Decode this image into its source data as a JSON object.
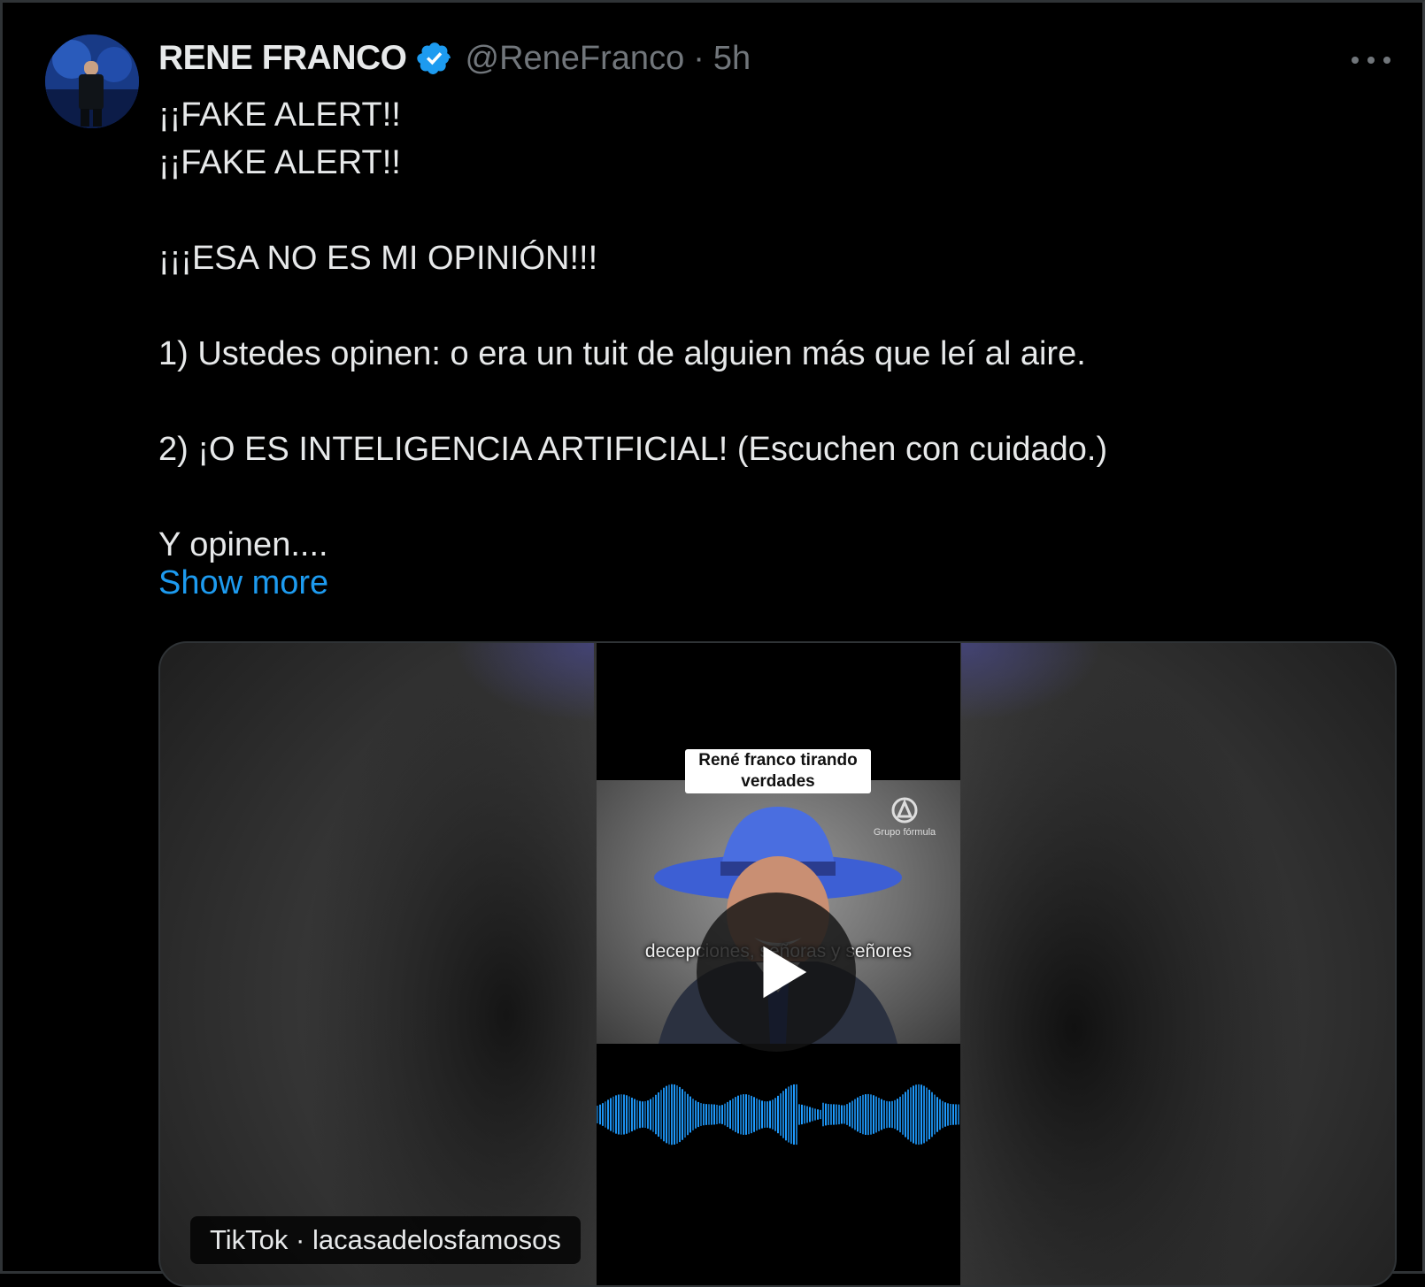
{
  "author": {
    "name": "RENE FRANCO",
    "handle": "@ReneFranco",
    "separator": "·",
    "time": "5h",
    "verified": true
  },
  "tweet": {
    "lines": [
      "¡¡FAKE ALERT!!",
      "¡¡FAKE ALERT!!",
      "",
      "¡¡¡ESA NO ES MI OPINIÓN!!!",
      "",
      "1) Ustedes opinen: o era un tuit de alguien más que leí al aire.",
      "",
      "2) ¡O ES INTELIGENCIA ARTIFICIAL! (Escuchen con cuidado.)",
      "",
      "Y opinen...."
    ],
    "show_more": "Show more"
  },
  "media": {
    "video_caption": "René franco tirando verdades",
    "logo_text": "Grupo fórmula",
    "subtitle": "decepciones, señoras y señores",
    "source_label": "TikTok · lacasadelosfamosos"
  },
  "colors": {
    "accent": "#1d9bf0",
    "text": "#e7e9ea",
    "muted": "#71767b",
    "background": "#000000",
    "waveform": "#1e9bff"
  },
  "icons": {
    "verified": "verified-badge-icon",
    "more": "more-dots-icon",
    "play": "play-icon"
  }
}
